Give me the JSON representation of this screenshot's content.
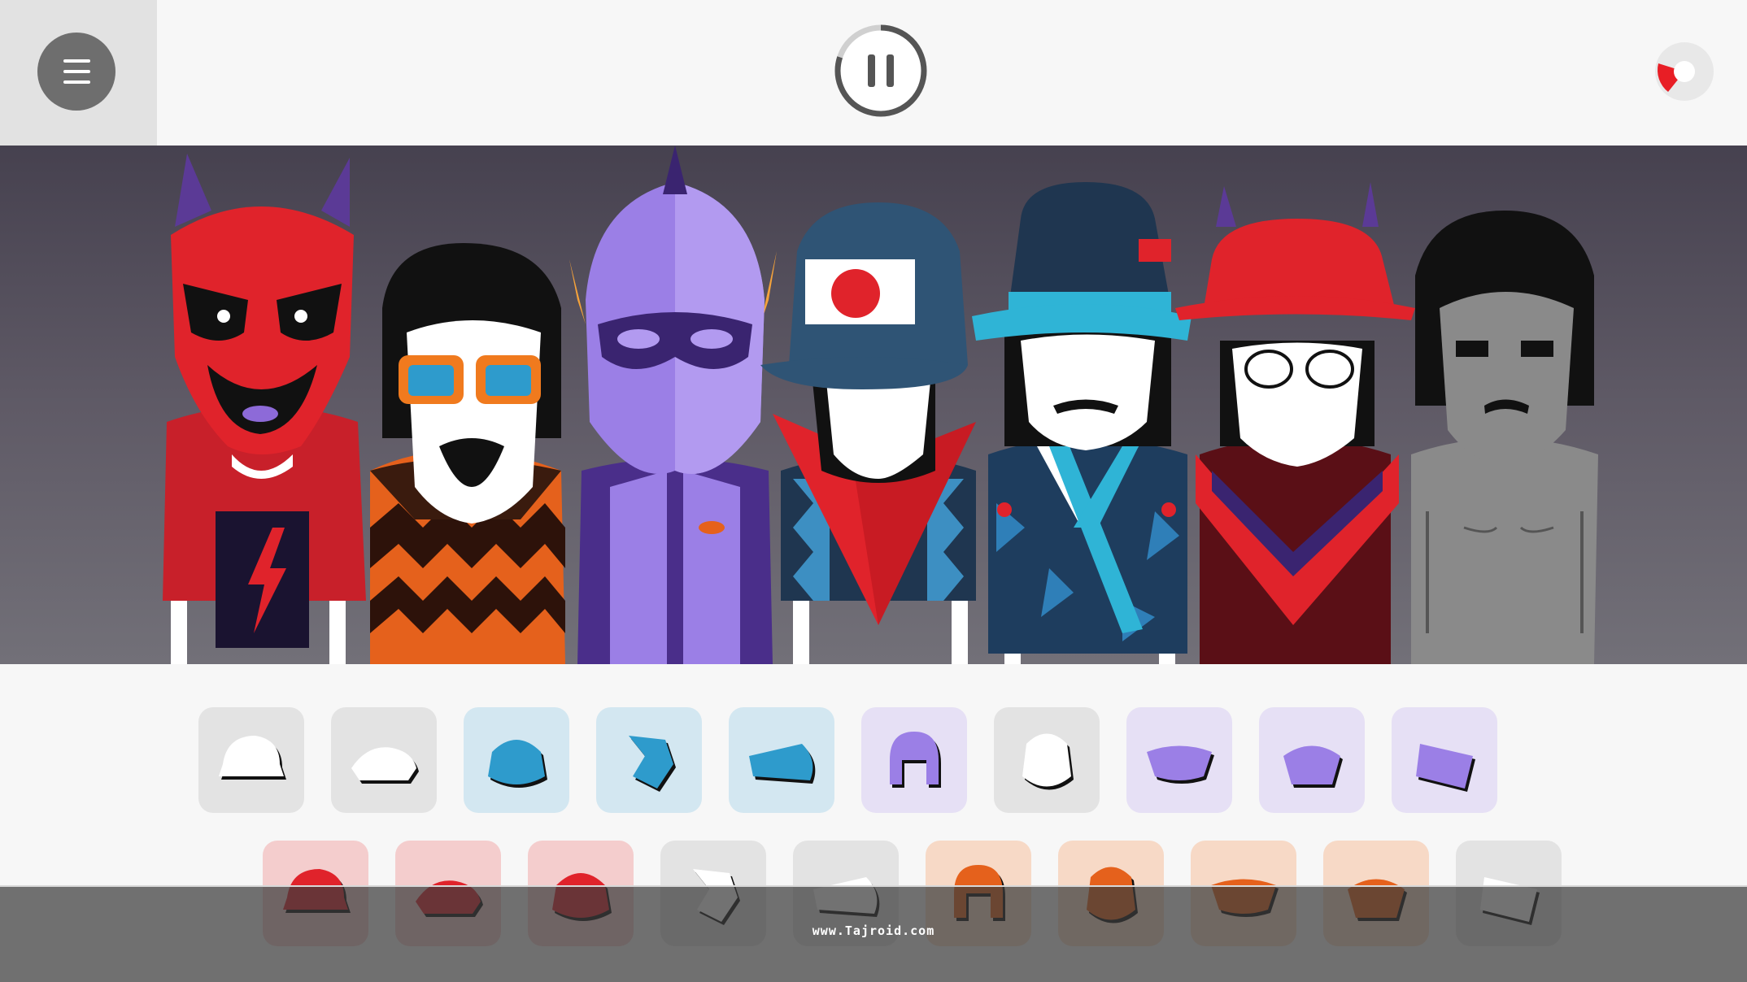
{
  "topbar": {
    "menu_icon": "hamburger-menu-icon",
    "pause_icon": "pause-icon",
    "record_icon": "record-icon",
    "pause_progress": 0.8,
    "colors": {
      "menu_bg": "#6e6e6e",
      "ring": "#555555",
      "record": "#e81e25"
    }
  },
  "stage": {
    "characters": [
      {
        "name": "red-demon-character",
        "accent": "#e0232b"
      },
      {
        "name": "orange-shades-character",
        "accent": "#e5611c"
      },
      {
        "name": "purple-masked-character",
        "accent": "#9b7fe6"
      },
      {
        "name": "japan-cap-character",
        "accent": "#2f5475"
      },
      {
        "name": "bucket-hat-character",
        "accent": "#2fb4d6"
      },
      {
        "name": "red-hat-character",
        "accent": "#e0232b"
      },
      {
        "name": "grey-silent-character",
        "accent": "#8a8a8a"
      }
    ]
  },
  "palette": {
    "row1": [
      {
        "name": "grey-cap-icon",
        "bg": "#e3e3e3",
        "fg": "#ffffff"
      },
      {
        "name": "grey-hat-icon",
        "bg": "#e3e3e3",
        "fg": "#ffffff"
      },
      {
        "name": "blue-mask-icon",
        "bg": "#d3e7f1",
        "fg": "#2e9bcc"
      },
      {
        "name": "blue-hand-icon",
        "bg": "#d3e7f1",
        "fg": "#2e9bcc"
      },
      {
        "name": "blue-visor-icon",
        "bg": "#d3e7f1",
        "fg": "#2e9bcc"
      },
      {
        "name": "purple-headphones-icon",
        "bg": "#e6e0f5",
        "fg": "#9b7fe6"
      },
      {
        "name": "grey-head-icon",
        "bg": "#e3e3e3",
        "fg": "#ffffff"
      },
      {
        "name": "purple-eye-mask-icon",
        "bg": "#e6e0f5",
        "fg": "#9b7fe6"
      },
      {
        "name": "purple-eyes-icon",
        "bg": "#e6e0f5",
        "fg": "#9b7fe6"
      },
      {
        "name": "purple-cassette-icon",
        "bg": "#e6e0f5",
        "fg": "#9b7fe6"
      }
    ],
    "row2": [
      {
        "name": "red-fist-icon",
        "bg": "#f4cdcd",
        "fg": "#e0232b"
      },
      {
        "name": "red-bow-icon",
        "bg": "#f4cdcd",
        "fg": "#e0232b"
      },
      {
        "name": "red-fox-icon",
        "bg": "#f4cdcd",
        "fg": "#e0232b"
      },
      {
        "name": "grey-helmet-icon",
        "bg": "#e3e3e3",
        "fg": "#ffffff"
      },
      {
        "name": "grey-mask-icon",
        "bg": "#e3e3e3",
        "fg": "#ffffff"
      },
      {
        "name": "orange-cap-icon",
        "bg": "#f7d9c6",
        "fg": "#e5611c"
      },
      {
        "name": "orange-goggles-icon",
        "bg": "#f7d9c6",
        "fg": "#e5611c"
      },
      {
        "name": "orange-band-icon",
        "bg": "#f7d9c6",
        "fg": "#e5611c"
      },
      {
        "name": "orange-cat-icon",
        "bg": "#f7d9c6",
        "fg": "#e5611c"
      },
      {
        "name": "grey-glasses-icon",
        "bg": "#e3e3e3",
        "fg": "#ffffff"
      }
    ]
  },
  "watermark": {
    "text": "www.Tajroid.com"
  }
}
